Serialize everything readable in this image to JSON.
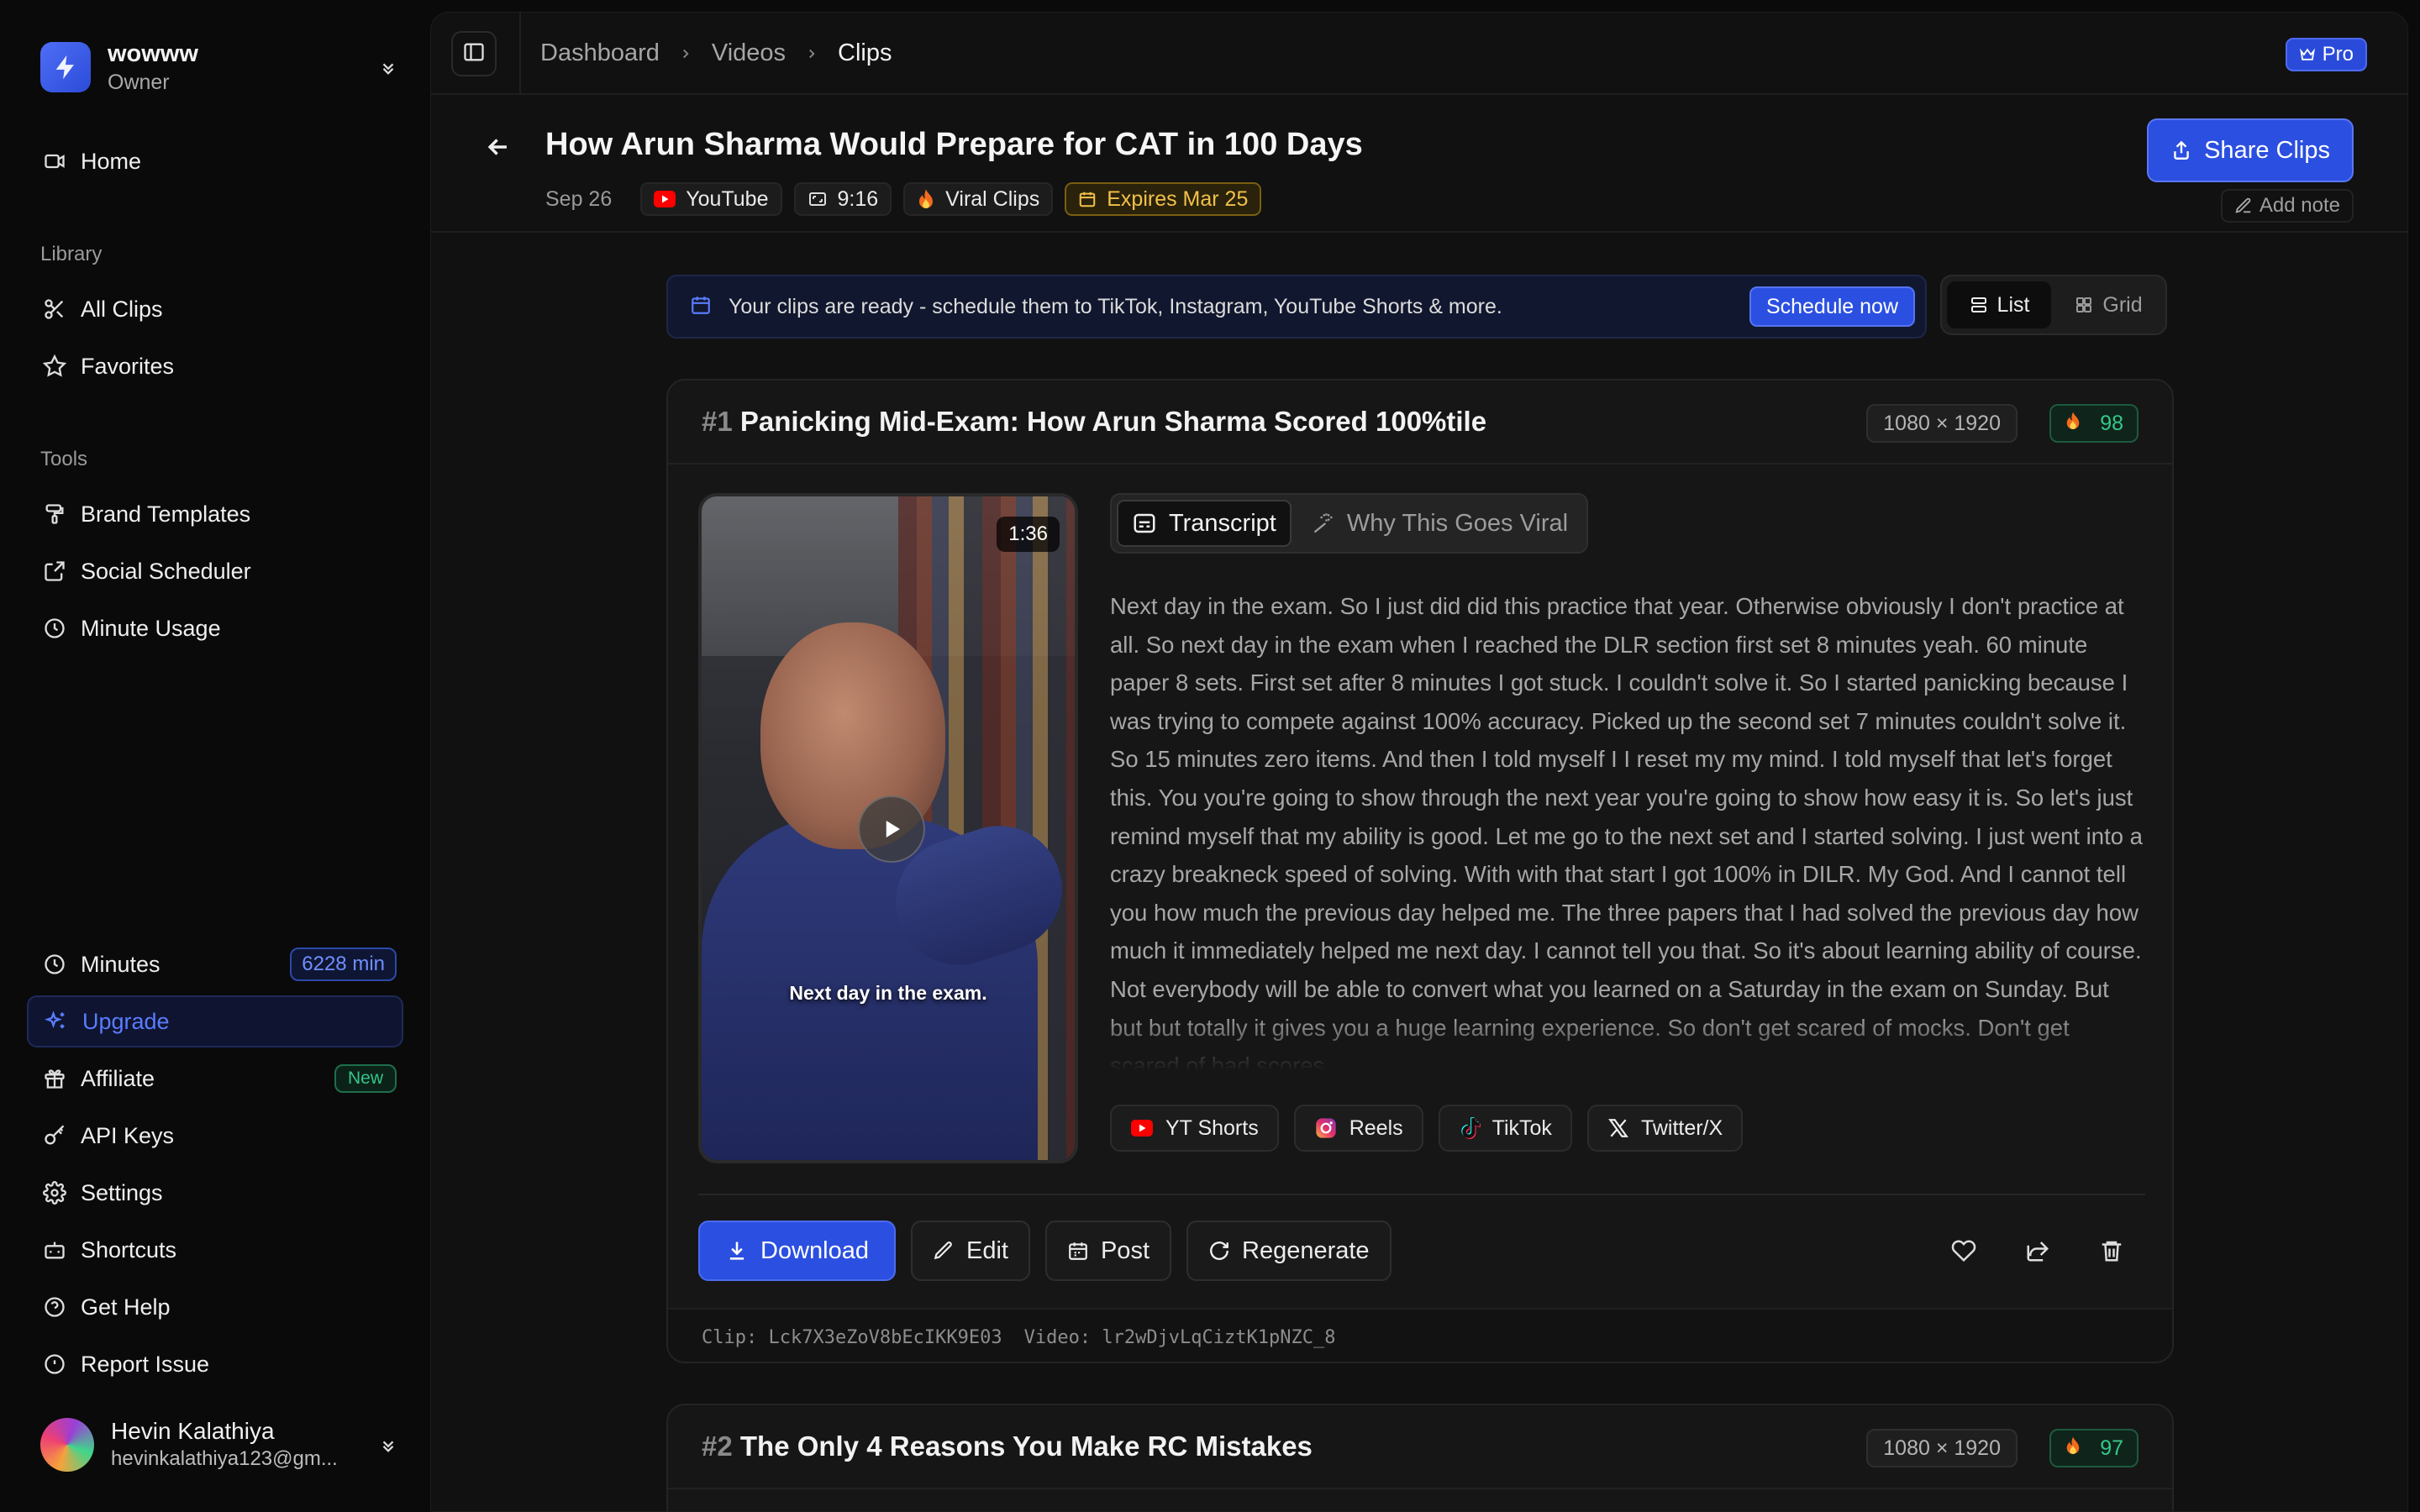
{
  "workspace": {
    "name": "wowww",
    "role": "Owner"
  },
  "nav": {
    "home": "Home",
    "library_label": "Library",
    "all_clips": "All Clips",
    "favorites": "Favorites",
    "tools_label": "Tools",
    "brand_templates": "Brand Templates",
    "social_scheduler": "Social Scheduler",
    "minute_usage": "Minute Usage",
    "minutes": "Minutes",
    "minutes_badge": "6228 min",
    "upgrade": "Upgrade",
    "affiliate": "Affiliate",
    "affiliate_badge": "New",
    "api_keys": "API Keys",
    "settings": "Settings",
    "shortcuts": "Shortcuts",
    "get_help": "Get Help",
    "report_issue": "Report Issue"
  },
  "user": {
    "name": "Hevin Kalathiya",
    "email": "hevinkalathiya123@gm..."
  },
  "breadcrumb": [
    "Dashboard",
    "Videos",
    "Clips"
  ],
  "plan_badge": "Pro",
  "video": {
    "title": "How Arun Sharma Would Prepare for CAT in 100 Days",
    "date": "Sep 26",
    "source": "YouTube",
    "aspect": "9:16",
    "category": "Viral Clips",
    "expires": "Expires Mar 25"
  },
  "share_button": "Share Clips",
  "add_note": "Add note",
  "banner": {
    "text": "Your clips are ready - schedule them to TikTok, Instagram, YouTube Shorts & more.",
    "cta": "Schedule now"
  },
  "view_toggle": {
    "list": "List",
    "grid": "Grid",
    "selected": "List"
  },
  "clips": [
    {
      "number": "#1",
      "title": "Panicking Mid-Exam: How Arun Sharma Scored 100%tile",
      "resolution": "1080 × 1920",
      "score": "98",
      "duration": "1:36",
      "caption": "Next day in the exam.",
      "tabs": {
        "transcript": "Transcript",
        "viral": "Why This Goes Viral",
        "selected": "Transcript"
      },
      "transcript": "Next day in the exam. So I just did did this practice that year. Otherwise obviously I don't practice at all. So next day in the exam when I reached the DLR section first set 8 minutes yeah. 60 minute paper 8 sets. First set after 8 minutes I got stuck. I couldn't solve it. So I started panicking because I was trying to compete against 100% accuracy. Picked up the second set 7 minutes couldn't solve it. So 15 minutes zero items. And then I told myself I I reset my my mind. I told myself that let's forget this. You you're going to show through the next year you're going to show how easy it is. So let's just remind myself that my ability is good. Let me go to the next set and I started solving. I just went into a crazy breakneck speed of solving. With with that start I got 100% in DILR. My God. And I cannot tell you how much the previous day helped me. The three papers that I had solved the previous day how much it immediately helped me next day. I cannot tell you that. So it's about learning ability of course. Not everybody will be able to convert what you learned on a Saturday in the exam on Sunday. But but but totally it gives you a huge learning experience. So don't get scared of mocks. Don't get scared of bad scores.",
      "platforms": [
        "YT Shorts",
        "Reels",
        "TikTok",
        "Twitter/X"
      ],
      "actions": {
        "download": "Download",
        "edit": "Edit",
        "post": "Post",
        "regenerate": "Regenerate"
      },
      "clip_id_label": "Clip: Lck7X3eZoV8bEcIKK9E03",
      "video_id_label": "Video: lr2wDjvLqCiztK1pNZC_8"
    },
    {
      "number": "#2",
      "title": "The Only 4 Reasons You Make RC Mistakes",
      "resolution": "1080 × 1920",
      "score": "97"
    }
  ],
  "colors": {
    "accent": "#2b4fe0",
    "score_green": "#36c88a",
    "expires_amber": "#f2c14a",
    "youtube_red": "#ff0000"
  }
}
